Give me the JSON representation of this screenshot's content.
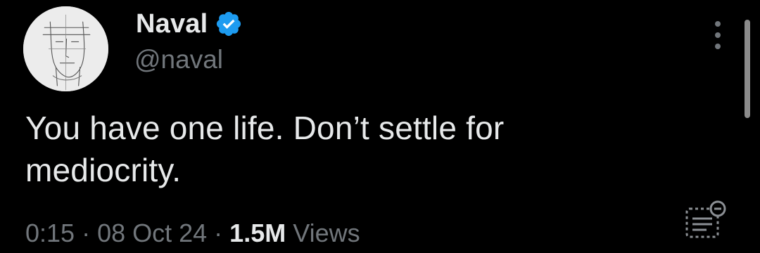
{
  "author": {
    "display_name": "Naval",
    "handle": "@naval",
    "verified": true,
    "verified_badge_color": "#1d9bf0"
  },
  "tweet": {
    "text": "You have one life. Don’t settle for mediocrity."
  },
  "meta": {
    "time": "0:15",
    "separator": "·",
    "date": "08 Oct 24",
    "views_count": "1.5M",
    "views_label": "Views"
  },
  "icons": {
    "more": "more-vertical-icon",
    "analytics": "post-analytics-icon",
    "verified": "verified-badge-icon"
  },
  "colors": {
    "background": "#000000",
    "primary_text": "#e7e9ea",
    "secondary_text": "#71767b"
  }
}
